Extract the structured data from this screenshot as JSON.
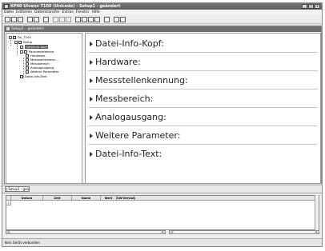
{
  "window": {
    "title": "KP40 Ulvann T100 (Unicode) - Setup1 - geändert",
    "controls": [
      "_",
      "□",
      "x"
    ]
  },
  "menu": {
    "items": [
      "Datei",
      "Editieren",
      "Datentransfer",
      "Extras",
      "Fenster",
      "Hilfe"
    ]
  },
  "child_window": {
    "title": "Setup1 - geändert"
  },
  "tree": {
    "root": "Dn_T100",
    "setup": "Setup",
    "selected": "Dateiinfo-Kopf",
    "parameters": "Parameterebene",
    "children": [
      "Hardware",
      "Messstellenkenn...",
      "Messbereich",
      "Analogausgang",
      "Weitere Parameter"
    ],
    "footer": "Datei-Info-Text"
  },
  "sections": [
    "Datei-Info-Kopf:",
    "Hardware:",
    "Messstellenkennung:",
    "Messbereich:",
    "Analogausgang:",
    "Weitere Parameter:",
    "Datei-Info-Text:"
  ],
  "document_tab": {
    "label": "Setup1 - gea"
  },
  "table": {
    "columns": [
      "Datum",
      "Zeit",
      "Name",
      "Wert",
      "SW-Version"
    ],
    "row_number": "1"
  },
  "status": {
    "text": "Kein Gerät verbunden"
  }
}
